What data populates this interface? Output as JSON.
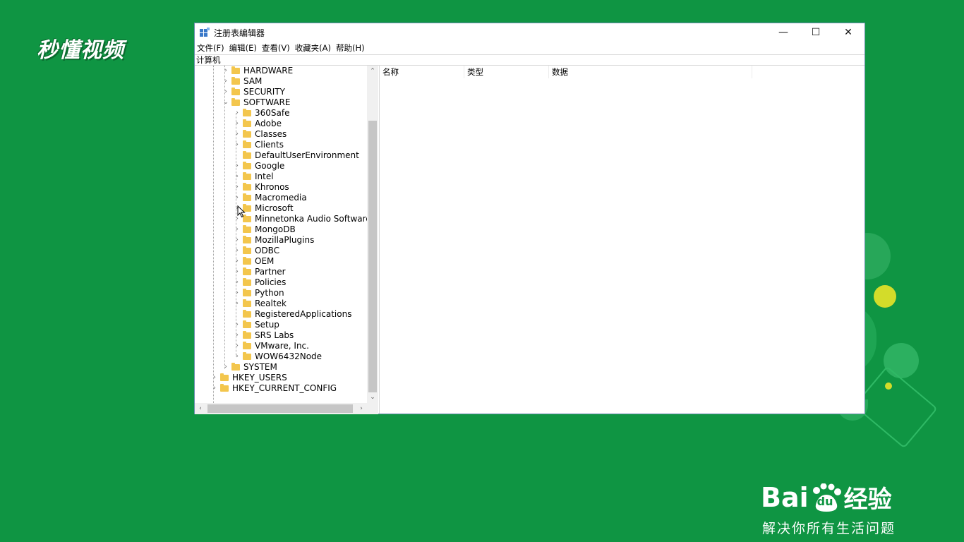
{
  "watermarks": {
    "top_left": "秒懂视频",
    "baidu_brand": "Bai",
    "baidu_brand_du": "du",
    "baidu_brand_suffix": "经验",
    "baidu_slogan": "解决你所有生活问题"
  },
  "window": {
    "title": "注册表编辑器",
    "controls": {
      "minimize": "—",
      "maximize": "☐",
      "close": "✕"
    },
    "menu": [
      "文件(F)",
      "编辑(E)",
      "查看(V)",
      "收藏夹(A)",
      "帮助(H)"
    ],
    "address": "计算机"
  },
  "tree": {
    "nodes": [
      {
        "label": "HARDWARE",
        "level": 2,
        "expander": "›"
      },
      {
        "label": "SAM",
        "level": 2,
        "expander": "›"
      },
      {
        "label": "SECURITY",
        "level": 2,
        "expander": "›"
      },
      {
        "label": "SOFTWARE",
        "level": 2,
        "expander": "⌄",
        "expanded": true
      },
      {
        "label": "360Safe",
        "level": 3,
        "expander": "›"
      },
      {
        "label": "Adobe",
        "level": 3,
        "expander": "›"
      },
      {
        "label": "Classes",
        "level": 3,
        "expander": "›"
      },
      {
        "label": "Clients",
        "level": 3,
        "expander": "›"
      },
      {
        "label": "DefaultUserEnvironment",
        "level": 3,
        "expander": ""
      },
      {
        "label": "Google",
        "level": 3,
        "expander": "›"
      },
      {
        "label": "Intel",
        "level": 3,
        "expander": "›"
      },
      {
        "label": "Khronos",
        "level": 3,
        "expander": "›"
      },
      {
        "label": "Macromedia",
        "level": 3,
        "expander": "›"
      },
      {
        "label": "Microsoft",
        "level": 3,
        "expander": "›"
      },
      {
        "label": "Minnetonka Audio Software",
        "level": 3,
        "expander": "›"
      },
      {
        "label": "MongoDB",
        "level": 3,
        "expander": "›"
      },
      {
        "label": "MozillaPlugins",
        "level": 3,
        "expander": "›"
      },
      {
        "label": "ODBC",
        "level": 3,
        "expander": "›"
      },
      {
        "label": "OEM",
        "level": 3,
        "expander": "›"
      },
      {
        "label": "Partner",
        "level": 3,
        "expander": "›"
      },
      {
        "label": "Policies",
        "level": 3,
        "expander": "›"
      },
      {
        "label": "Python",
        "level": 3,
        "expander": "›"
      },
      {
        "label": "Realtek",
        "level": 3,
        "expander": "›"
      },
      {
        "label": "RegisteredApplications",
        "level": 3,
        "expander": ""
      },
      {
        "label": "Setup",
        "level": 3,
        "expander": "›"
      },
      {
        "label": "SRS Labs",
        "level": 3,
        "expander": "›"
      },
      {
        "label": "VMware, Inc.",
        "level": 3,
        "expander": "›"
      },
      {
        "label": "WOW6432Node",
        "level": 3,
        "expander": "›"
      },
      {
        "label": "SYSTEM",
        "level": 2,
        "expander": "›"
      },
      {
        "label": "HKEY_USERS",
        "level": 1,
        "expander": "›"
      },
      {
        "label": "HKEY_CURRENT_CONFIG",
        "level": 1,
        "expander": "›"
      }
    ],
    "scroll": {
      "up": "⌃",
      "down": "⌄",
      "left": "‹",
      "right": "›"
    }
  },
  "values": {
    "columns": [
      "名称",
      "类型",
      "数据"
    ]
  },
  "colors": {
    "background": "#0f9543",
    "folder": "#f3c64d",
    "window_border": "#6c8fb0"
  }
}
